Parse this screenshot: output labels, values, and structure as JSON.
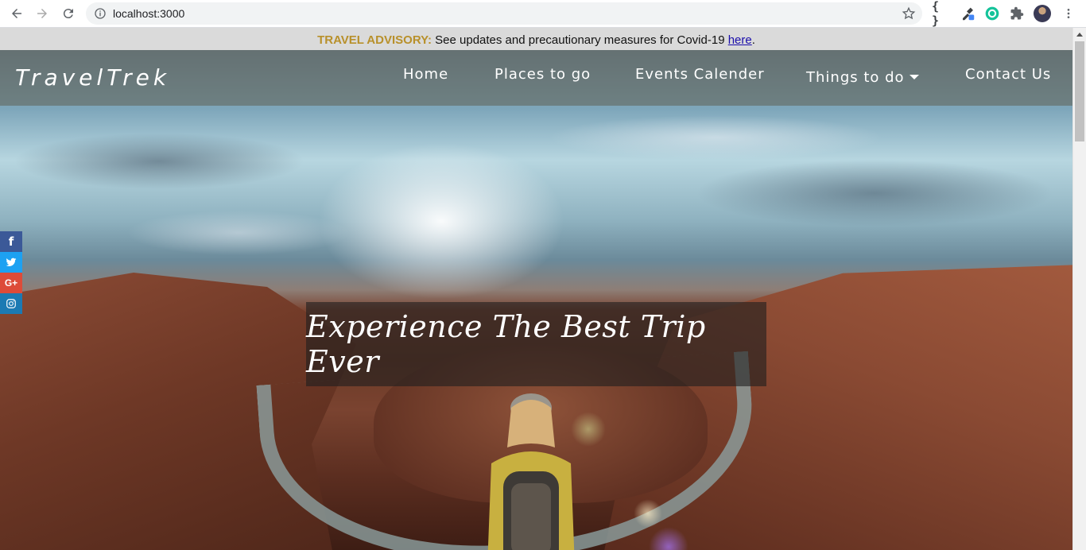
{
  "browser": {
    "url": "localhost:3000",
    "ext_code_icon": "{ }"
  },
  "advisory": {
    "lead": "TRAVEL ADVISORY:",
    "text": " See updates and precautionary measures for Covid-19 ",
    "link": "here",
    "tail": "."
  },
  "nav": {
    "brand": "TravelTrek",
    "items": [
      "Home",
      "Places to go",
      "Events Calender",
      "Things to do",
      "Contact Us"
    ]
  },
  "social": {
    "facebook": "f",
    "google": "G+"
  },
  "colors": {
    "facebook": "#3b5998",
    "twitter": "#1da1f2",
    "google": "#dd4b39",
    "instagram": "#1b7ab3",
    "advisory_lead": "#b8902a"
  },
  "hero": {
    "tagline": "Experience The Best Trip Ever"
  }
}
